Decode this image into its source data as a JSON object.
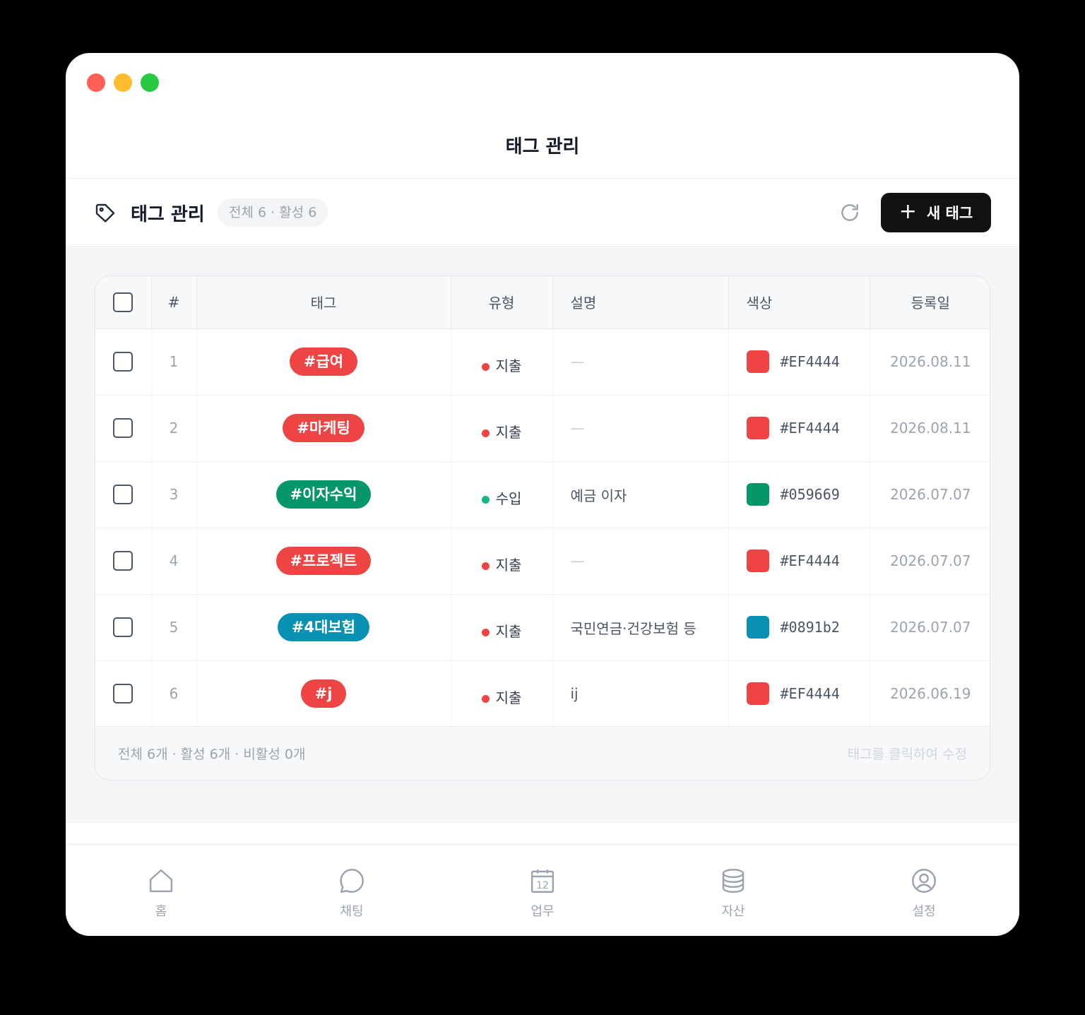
{
  "window": {
    "title": "태그 관리"
  },
  "toolbar": {
    "title": "태그 관리",
    "count_pill": "전체 6 · 활성 6",
    "new_button_label": "새 태그",
    "icon": "tag-icon"
  },
  "table": {
    "headers": [
      "#",
      "태그",
      "유형",
      "설명",
      "색상",
      "등록일"
    ],
    "rows": [
      {
        "num": "1",
        "tag": "#급여",
        "type": "지출",
        "type_color": "#ef4444",
        "desc": "—",
        "color": "#EF4444",
        "date": "2026.08.11"
      },
      {
        "num": "2",
        "tag": "#마케팅",
        "type": "지출",
        "type_color": "#ef4444",
        "desc": "—",
        "color": "#EF4444",
        "date": "2026.08.11"
      },
      {
        "num": "3",
        "tag": "#이자수익",
        "type": "수입",
        "type_color": "#10b981",
        "desc": "예금 이자",
        "color": "#059669",
        "date": "2026.07.07"
      },
      {
        "num": "4",
        "tag": "#프로젝트",
        "type": "지출",
        "type_color": "#ef4444",
        "desc": "—",
        "color": "#EF4444",
        "date": "2026.07.07"
      },
      {
        "num": "5",
        "tag": "#4대보험",
        "type": "지출",
        "type_color": "#ef4444",
        "desc": "국민연금·건강보험 등",
        "color": "#0891b2",
        "date": "2026.07.07"
      },
      {
        "num": "6",
        "tag": "#j",
        "type": "지출",
        "type_color": "#ef4444",
        "desc": "ij",
        "color": "#EF4444",
        "date": "2026.06.19"
      }
    ]
  },
  "footer": {
    "summary": "전체 6개 · 활성 6개 · 비활성 0개",
    "hint": "태그를 클릭하여 수정"
  },
  "nav": [
    {
      "label": "홈",
      "icon": "home-icon"
    },
    {
      "label": "채팅",
      "icon": "chat-icon"
    },
    {
      "label": "업무",
      "icon": "calendar-icon",
      "badge": "12"
    },
    {
      "label": "자산",
      "icon": "database-icon"
    },
    {
      "label": "설정",
      "icon": "user-circle-icon"
    }
  ]
}
